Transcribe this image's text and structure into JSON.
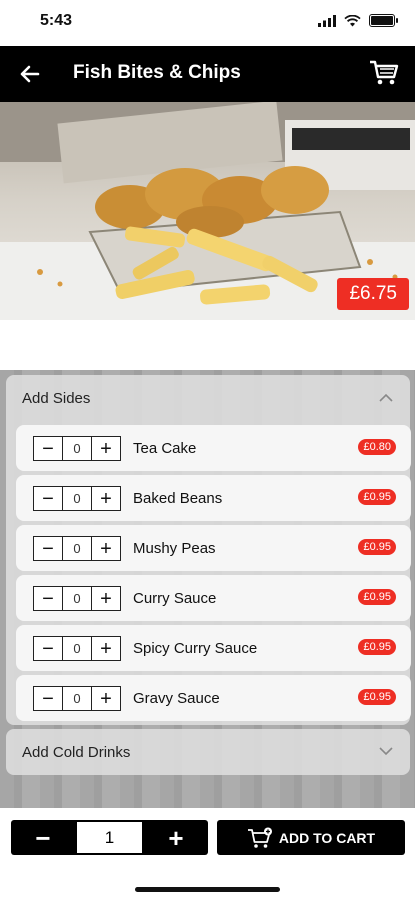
{
  "status_bar": {
    "time": "5:43"
  },
  "header": {
    "title": "Fish Bites & Chips",
    "back_icon": "arrow-left-icon",
    "cart_icon": "cart-icon"
  },
  "hero": {
    "price": "£6.75"
  },
  "sides_panel": {
    "title": "Add Sides",
    "items": [
      {
        "name": "Tea Cake",
        "price": "£0.80",
        "quantity": "0"
      },
      {
        "name": "Baked Beans",
        "price": "£0.95",
        "quantity": "0"
      },
      {
        "name": "Mushy Peas",
        "price": "£0.95",
        "quantity": "0"
      },
      {
        "name": "Curry Sauce",
        "price": "£0.95",
        "quantity": "0"
      },
      {
        "name": "Spicy Curry Sauce",
        "price": "£0.95",
        "quantity": "0"
      },
      {
        "name": "Gravy Sauce",
        "price": "£0.95",
        "quantity": "0"
      }
    ]
  },
  "drinks_panel": {
    "title": "Add Cold Drinks"
  },
  "bottom_bar": {
    "quantity": "1",
    "minus_label": "−",
    "plus_label": "+",
    "add_to_cart_label": "ADD TO CART"
  },
  "colors": {
    "accent": "#ee2e24",
    "header_bg": "#000000"
  }
}
